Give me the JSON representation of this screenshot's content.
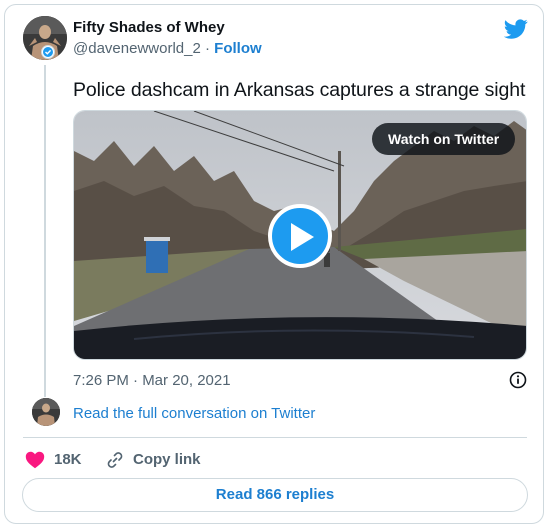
{
  "author": {
    "display_name": "Fifty Shades of Whey",
    "handle": "@davenewworld_2",
    "separator": " · ",
    "follow_label": "Follow"
  },
  "tweet": {
    "text": "Police dashcam in Arkansas captures a strange sight",
    "timestamp": "7:26 PM · Mar 20, 2021"
  },
  "media": {
    "watch_label": "Watch on Twitter",
    "play_icon": "play-icon"
  },
  "conversation": {
    "link_label": "Read the full conversation on Twitter"
  },
  "actions": {
    "like_count": "18K",
    "copy_link_label": "Copy link",
    "read_replies_label": "Read 866 replies"
  },
  "colors": {
    "twitter_blue": "#1d9bf0",
    "link_blue": "#1d7fd0",
    "heart_pink": "#f91880",
    "muted_text": "#536471",
    "border": "#cfd9de"
  },
  "icons": {
    "logo": "twitter-bird-icon",
    "info": "info-icon",
    "heart": "heart-icon",
    "link": "link-icon",
    "badge": "verified-badge-icon"
  }
}
